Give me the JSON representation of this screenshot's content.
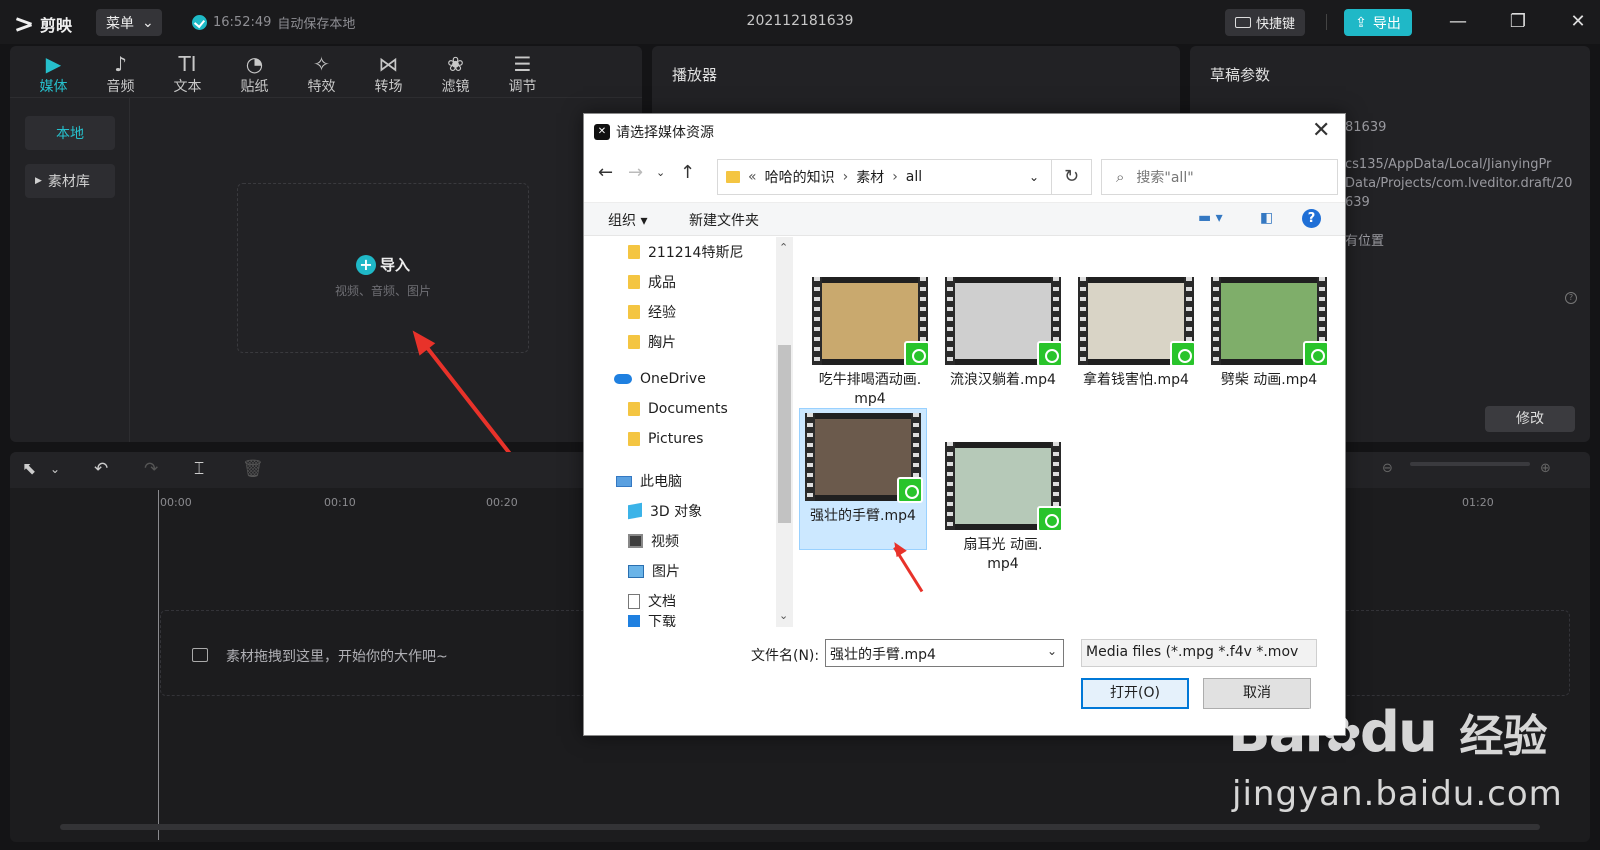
{
  "app": {
    "name": "剪映",
    "menu_label": "菜单",
    "autosave_time": "16:52:49",
    "autosave_text": "自动保存本地",
    "project_title": "202112181639",
    "shortcut_label": "快捷键",
    "export_label": "导出"
  },
  "media_tabs": [
    {
      "label": "媒体",
      "icon": "▶"
    },
    {
      "label": "音频",
      "icon": "♪"
    },
    {
      "label": "文本",
      "icon": "TI"
    },
    {
      "label": "贴纸",
      "icon": "◔"
    },
    {
      "label": "特效",
      "icon": "✧"
    },
    {
      "label": "转场",
      "icon": "⋈"
    },
    {
      "label": "滤镜",
      "icon": "❀"
    },
    {
      "label": "调节",
      "icon": "☰"
    }
  ],
  "media_side": {
    "local": "本地",
    "library": "素材库"
  },
  "import": {
    "title": "导入",
    "subtitle": "视频、音频、图片"
  },
  "player": {
    "title": "播放器"
  },
  "draft": {
    "title": "草稿参数",
    "line1": "81639",
    "line2": "cs135/AppData/Local/JianyingPr",
    "line3": "Data/Projects/com.lveditor.draft/20",
    "line4": "639",
    "line5": "有位置",
    "modify_label": "修改"
  },
  "timeline": {
    "ruler": [
      "00:00",
      "00:10",
      "00:20",
      "01:20"
    ],
    "drop_text": "素材拖拽到这里，开始你的大作吧~"
  },
  "dialog": {
    "title": "请选择媒体资源",
    "breadcrumb": [
      "哈哈的知识",
      "素材",
      "all"
    ],
    "breadcrumb_prefix": "«",
    "search_placeholder": "搜索\"all\"",
    "organize": "组织 ▾",
    "new_folder": "新建文件夹",
    "tree": [
      {
        "label": "211214特斯尼",
        "icon": "folder"
      },
      {
        "label": "成品",
        "icon": "folder"
      },
      {
        "label": "经验",
        "icon": "folder"
      },
      {
        "label": "胸片",
        "icon": "folder"
      },
      {
        "label": "OneDrive",
        "icon": "cloud"
      },
      {
        "label": "Documents",
        "icon": "folder"
      },
      {
        "label": "Pictures",
        "icon": "folder"
      },
      {
        "label": "此电脑",
        "icon": "pc"
      },
      {
        "label": "3D 对象",
        "icon": "cube"
      },
      {
        "label": "视频",
        "icon": "video"
      },
      {
        "label": "图片",
        "icon": "picture"
      },
      {
        "label": "文档",
        "icon": "document"
      },
      {
        "label": "下载",
        "icon": "download"
      }
    ],
    "files": [
      {
        "name": "吃牛排喝酒动画.mp4",
        "name_l1": "吃牛排喝酒动画.",
        "name_l2": "mp4",
        "scene": "#c9a96e"
      },
      {
        "name": "流浪汉躺着.mp4",
        "name_l1": "流浪汉躺着.mp4",
        "name_l2": "",
        "scene": "#cfcfcf"
      },
      {
        "name": "拿着钱害怕.mp4",
        "name_l1": "拿着钱害怕.mp4",
        "name_l2": "",
        "scene": "#d9d4c6"
      },
      {
        "name": "劈柴 动画.mp4",
        "name_l1": "劈柴 动画.mp4",
        "name_l2": "",
        "scene": "#7fae6a"
      },
      {
        "name": "强壮的手臂.mp4",
        "name_l1": "强壮的手臂.mp4",
        "name_l2": "",
        "scene": "#6b5a4c"
      },
      {
        "name": "扇耳光 动画.mp4",
        "name_l1": "扇耳光 动画.",
        "name_l2": "mp4",
        "scene": "#b6c9b8"
      }
    ],
    "file_name_label": "文件名(N):",
    "file_name_value": "强壮的手臂.mp4",
    "file_type_value": "Media files (*.mpg *.f4v *.mov",
    "open_label": "打开(O)",
    "cancel_label": "取消"
  },
  "watermark": {
    "brand": "Bai",
    "du": "du",
    "jingyan": "经验",
    "url": "jingyan.baidu.com"
  },
  "colors": {
    "accent": "#1fb8c7",
    "background": "#141416",
    "panel": "#222225",
    "badge": "#29c42b"
  }
}
